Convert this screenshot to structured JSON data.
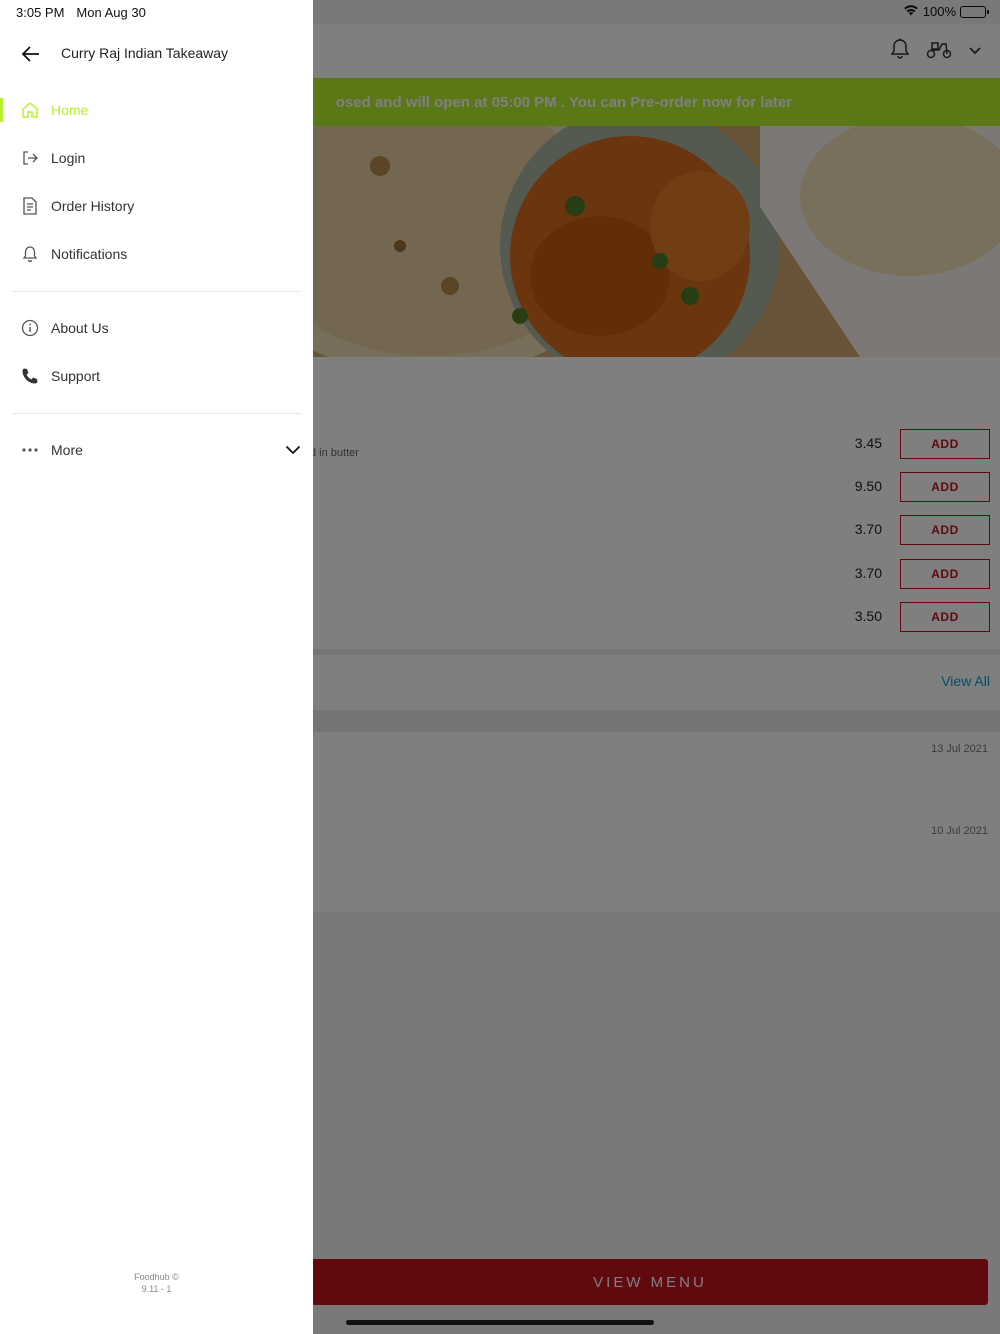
{
  "status_bar": {
    "time": "3:05 PM",
    "date": "Mon Aug 30",
    "battery": "100%"
  },
  "drawer": {
    "title": "Curry Raj Indian Takeaway",
    "nav": [
      {
        "label": "Home",
        "icon": "home-icon",
        "active": true
      },
      {
        "label": "Login",
        "icon": "login-icon"
      },
      {
        "label": "Order History",
        "icon": "document-icon"
      },
      {
        "label": "Notifications",
        "icon": "bell-icon"
      }
    ],
    "nav2": [
      {
        "label": "About Us",
        "icon": "info-icon"
      },
      {
        "label": "Support",
        "icon": "phone-icon"
      }
    ],
    "more_label": "More",
    "footer_line1": "Foodhub ©",
    "footer_line2": "9.11 - 1"
  },
  "background": {
    "banner_text": "osed and will open at 05:00 PM . You can Pre-order now for later",
    "item_description_fragment": "d in butter",
    "items": [
      {
        "price": "3.45",
        "button": "ADD"
      },
      {
        "price": "9.50",
        "button": "ADD"
      },
      {
        "price": "3.70",
        "button": "ADD"
      },
      {
        "price": "3.70",
        "button": "ADD"
      },
      {
        "price": "3.50",
        "button": "ADD"
      }
    ],
    "view_all": "View All",
    "reviews": [
      {
        "date": "13 Jul 2021"
      },
      {
        "date": "10 Jul 2021"
      }
    ],
    "view_menu": "VIEW MENU"
  },
  "colors": {
    "accent_green": "#b6f02c",
    "brand_red": "#c1121f",
    "link_blue": "#0a9ad6"
  }
}
